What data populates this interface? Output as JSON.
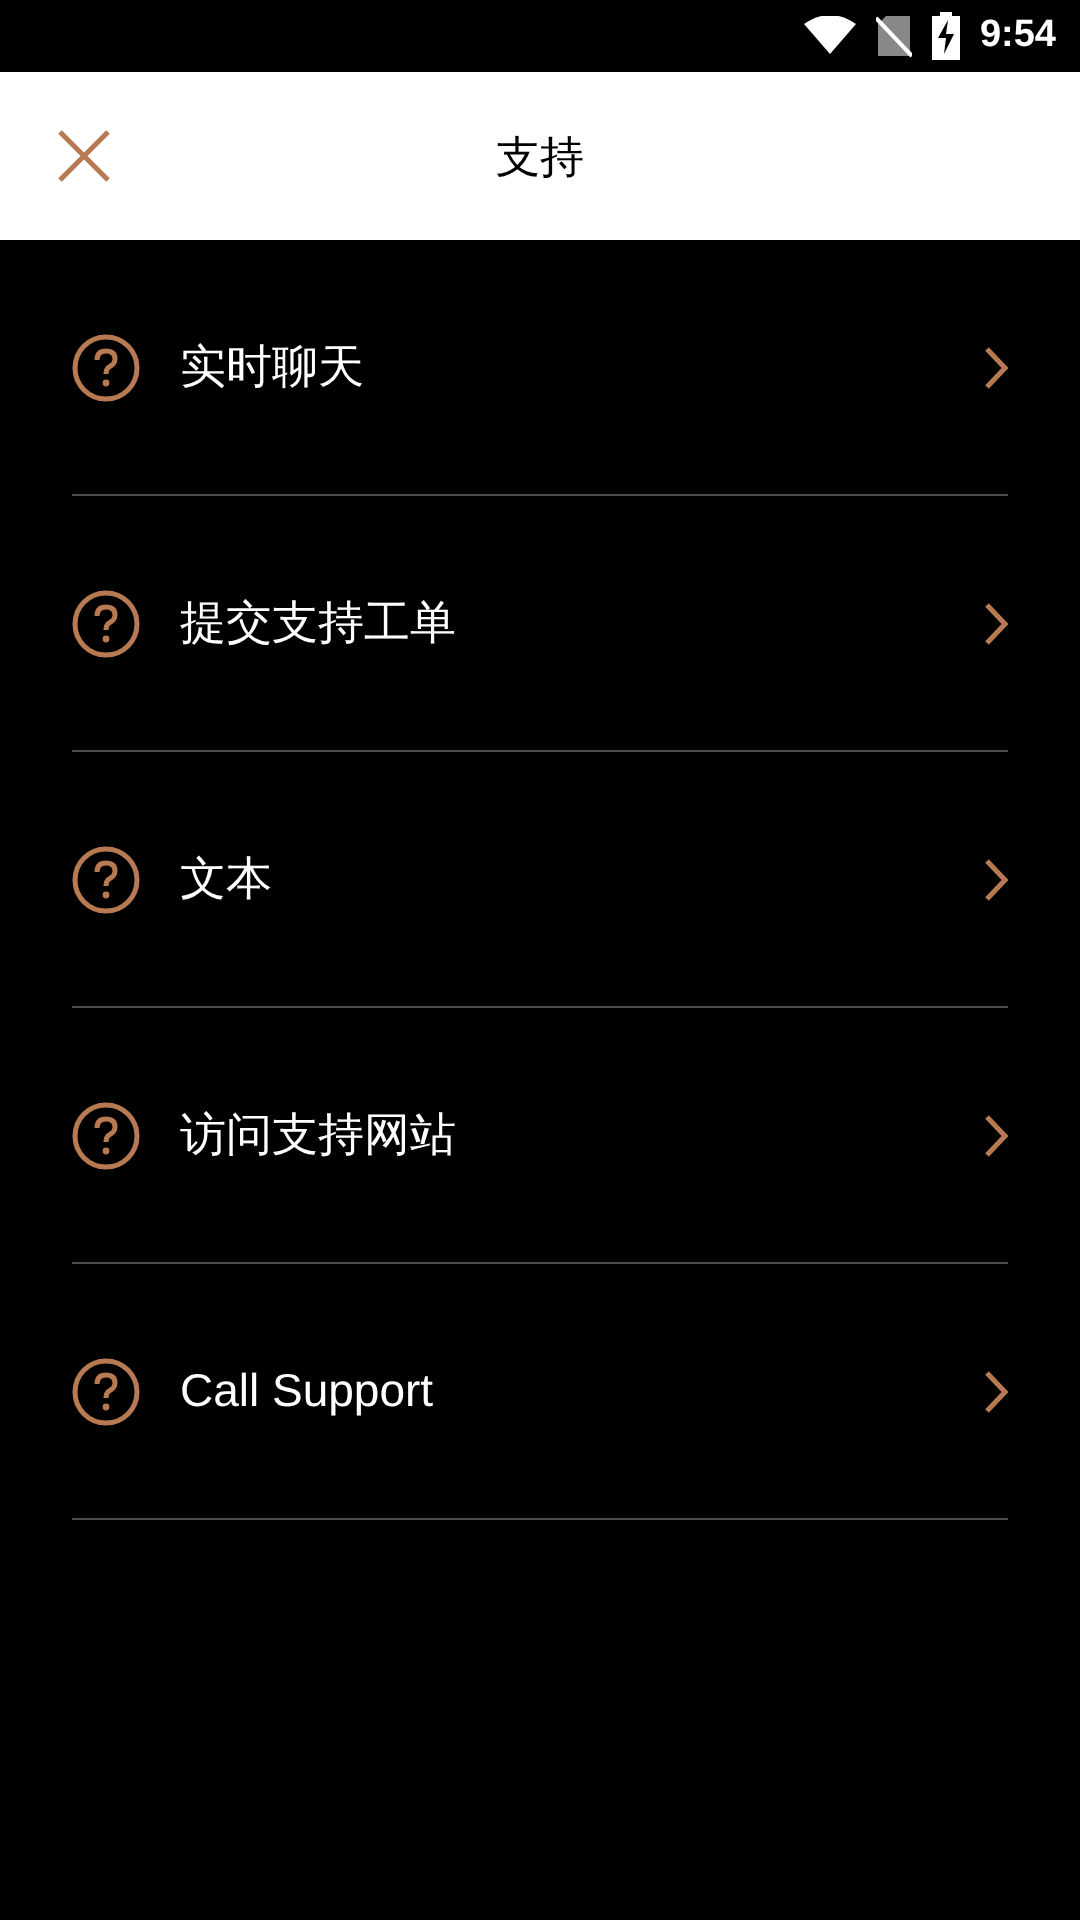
{
  "status_bar": {
    "time": "9:54"
  },
  "header": {
    "title": "支持"
  },
  "items": [
    {
      "label": "实时聊天"
    },
    {
      "label": "提交支持工单"
    },
    {
      "label": "文本"
    },
    {
      "label": "访问支持网站"
    },
    {
      "label": "Call Support"
    }
  ]
}
